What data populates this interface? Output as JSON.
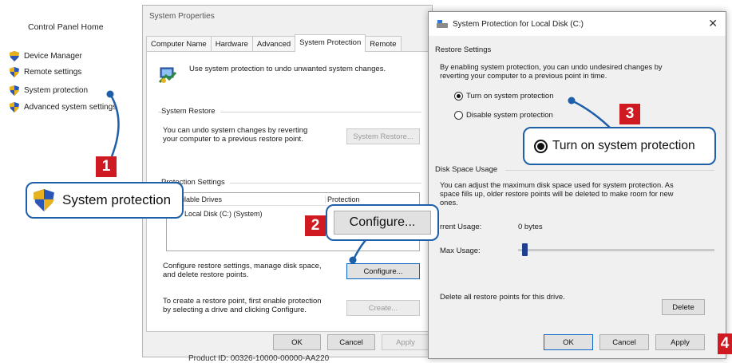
{
  "control_panel": {
    "home": "Control Panel Home",
    "links": [
      "Device Manager",
      "Remote settings",
      "System protection",
      "Advanced system settings"
    ]
  },
  "system_properties": {
    "title": "System Properties",
    "tabs": [
      "Computer Name",
      "Hardware",
      "Advanced",
      "System Protection",
      "Remote"
    ],
    "active_tab": "System Protection",
    "intro": "Use system protection to undo unwanted system changes.",
    "system_restore": {
      "label": "System Restore",
      "text_line1": "You can undo system changes by reverting",
      "text_line2": "your computer to a previous restore point.",
      "button": "System Restore..."
    },
    "protection_settings": {
      "label": "Protection Settings",
      "col_drives": "ilable Drives",
      "col_protection": "Protection",
      "drive": "Local Disk (C:) (System)"
    },
    "configure_text_line1": "Configure restore settings, manage disk space,",
    "configure_text_line2": "and delete restore points.",
    "configure_button": "Configure...",
    "create_text_line1": "To create a restore point, first enable protection",
    "create_text_line2": "by selecting a drive and clicking Configure.",
    "create_button": "Create...",
    "ok": "OK",
    "cancel": "Cancel",
    "apply": "Apply",
    "product_id": "Product ID: 00326-10000-00000-AA220"
  },
  "protection_dialog": {
    "title": "System Protection for Local Disk (C:)",
    "restore_settings_label": "Restore Settings",
    "restore_text_line1": "By enabling system protection, you can undo undesired changes by",
    "restore_text_line2": "reverting your computer to a previous point in time.",
    "radio_on": "Turn on system protection",
    "radio_off": "Disable system protection",
    "selected": "Turn on system protection",
    "disk_space_label": "Disk Space Usage",
    "disk_text_line1": "You can adjust the maximum disk space used for system protection. As",
    "disk_text_line2": "space fills up, older restore points will be deleted to make room for new",
    "disk_text_line3": "ones.",
    "current_usage_label": "rrent Usage:",
    "current_usage_value": "0 bytes",
    "max_usage_label": "Max Usage:",
    "max_usage_fraction": 0.02,
    "delete_text": "Delete all restore points for this drive.",
    "delete_button": "Delete",
    "ok": "OK",
    "cancel": "Cancel",
    "apply": "Apply"
  },
  "callouts": {
    "c1": {
      "number": "1",
      "text": "System protection"
    },
    "c2": {
      "number": "2",
      "text": "Configure..."
    },
    "c3": {
      "number": "3",
      "text": "Turn on system protection"
    },
    "c4": {
      "number": "4"
    }
  },
  "colors": {
    "callout_border": "#1e5faa",
    "badge": "#cf1a22",
    "shield_blue": "#2a56b8",
    "shield_gold": "#e8b21e"
  }
}
